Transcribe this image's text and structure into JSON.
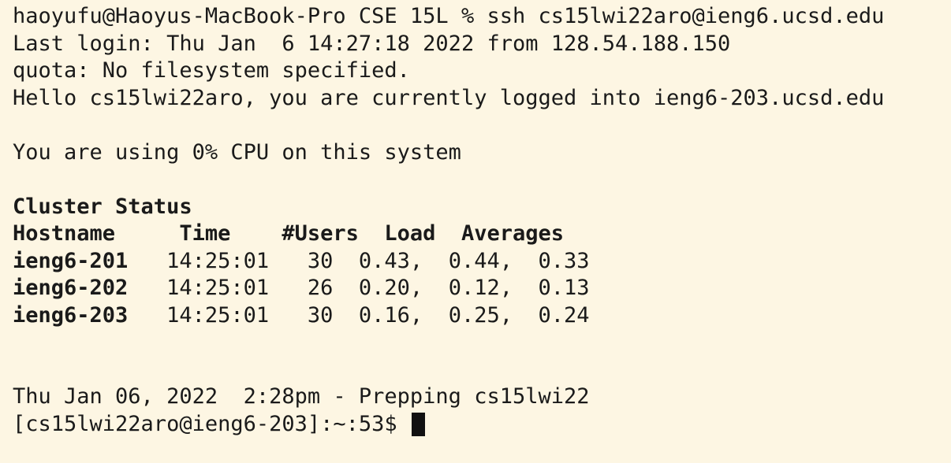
{
  "terminal": {
    "background": "#fdf6e3",
    "foreground": "#1a1a1a",
    "command_line": "haoyufu@Haoyus-MacBook-Pro CSE 15L % ssh cs15lwi22aro@ieng6.ucsd.edu",
    "last_login": "Last login: Thu Jan  6 14:27:18 2022 from 128.54.188.150",
    "quota": "quota: No filesystem specified.",
    "hello": "Hello cs15lwi22aro, you are currently logged into ieng6-203.ucsd.edu",
    "cpu": "You are using 0% CPU on this system",
    "cluster_title": "Cluster Status",
    "cluster_header": "Hostname     Time    #Users  Load  Averages",
    "cluster_rows": [
      {
        "host": "ieng6-201",
        "rest": "   14:25:01   30  0.43,  0.44,  0.33"
      },
      {
        "host": "ieng6-202",
        "rest": "   14:25:01   26  0.20,  0.12,  0.13"
      },
      {
        "host": "ieng6-203",
        "rest": "   14:25:01   30  0.16,  0.25,  0.24"
      }
    ],
    "prepping": "Thu Jan 06, 2022  2:28pm - Prepping cs15lwi22",
    "prompt": "[cs15lwi22aro@ieng6-203]:~:53$ "
  }
}
